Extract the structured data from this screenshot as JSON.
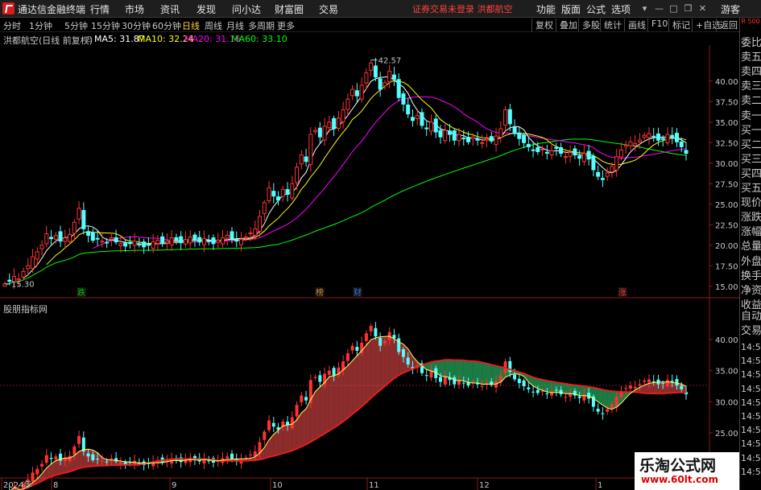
{
  "app": {
    "title": "通达信金融终端",
    "notice": "证券交易未登录 洪都航空",
    "guest": "游客",
    "corner": "R 500"
  },
  "menu": [
    "行情",
    "市场",
    "资讯",
    "发现",
    "问小达",
    "财富圈",
    "交易"
  ],
  "right_menu": [
    "功能",
    "版面",
    "公式",
    "选项"
  ],
  "periods": [
    "分时",
    "1分钟",
    "5分钟",
    "15分钟",
    "30分钟",
    "60分钟",
    "日线",
    "周线",
    "月线",
    "多周期",
    "更多"
  ],
  "active_period": "日线",
  "tools": [
    "复权",
    "叠加",
    "多股",
    "统计",
    "画线",
    "F10",
    "标记",
    "+自选",
    "返回"
  ],
  "info": {
    "stock": "洪都航空(日线 前复权)",
    "ma5": "MA5: 31.87",
    "ma10": "MA10: 32.24",
    "ma20": "MA20: 31.16",
    "ma60": "MA60: 33.10"
  },
  "right_panel": {
    "top": [
      "委比",
      "卖五",
      "卖四",
      "卖三",
      "卖二",
      "卖一",
      "买一",
      "买二",
      "买三",
      "买四",
      "买五",
      "现价",
      "涨跌",
      "涨幅",
      "总量",
      "外盘",
      "换手",
      "净资",
      "收益"
    ],
    "bottom": [
      "自动",
      "交易",
      "14:56",
      "14:56",
      "14:56",
      "14:56",
      "14:56",
      "14:56",
      "14:56",
      "14:56",
      "14:56",
      "14:56"
    ]
  },
  "sub_indicator": "股朋指标网",
  "chart_data": {
    "type": "candlestick",
    "main": {
      "y_ticks": [
        "40.00",
        "37.50",
        "35.00",
        "32.50",
        "30.00",
        "27.50",
        "25.00",
        "22.50",
        "20.00",
        "17.50",
        "15.00"
      ],
      "y_range": [
        14.0,
        44.0
      ],
      "high_label": "42.57",
      "low_label": "15.30",
      "markers": [
        "跌",
        "榜",
        "财",
        "涨"
      ]
    },
    "sub": {
      "y_ticks": [
        "40.00",
        "35.00",
        "30.00",
        "25.00"
      ],
      "y_range": [
        18.0,
        43.5
      ]
    },
    "x_labels": [
      "2024年",
      "8",
      "9",
      "10",
      "11",
      "12",
      "1"
    ],
    "colors": {
      "up": "#ff3232",
      "down": "#54ffff",
      "ma5": "#ffffff",
      "ma10": "#ffff00",
      "ma20": "#ff00ff",
      "ma60": "#00ff00",
      "sub_line": "#e61e1e",
      "band": "#ff5050"
    }
  },
  "watermark": {
    "title": "乐淘公式网",
    "url": "www.60lt.com"
  }
}
